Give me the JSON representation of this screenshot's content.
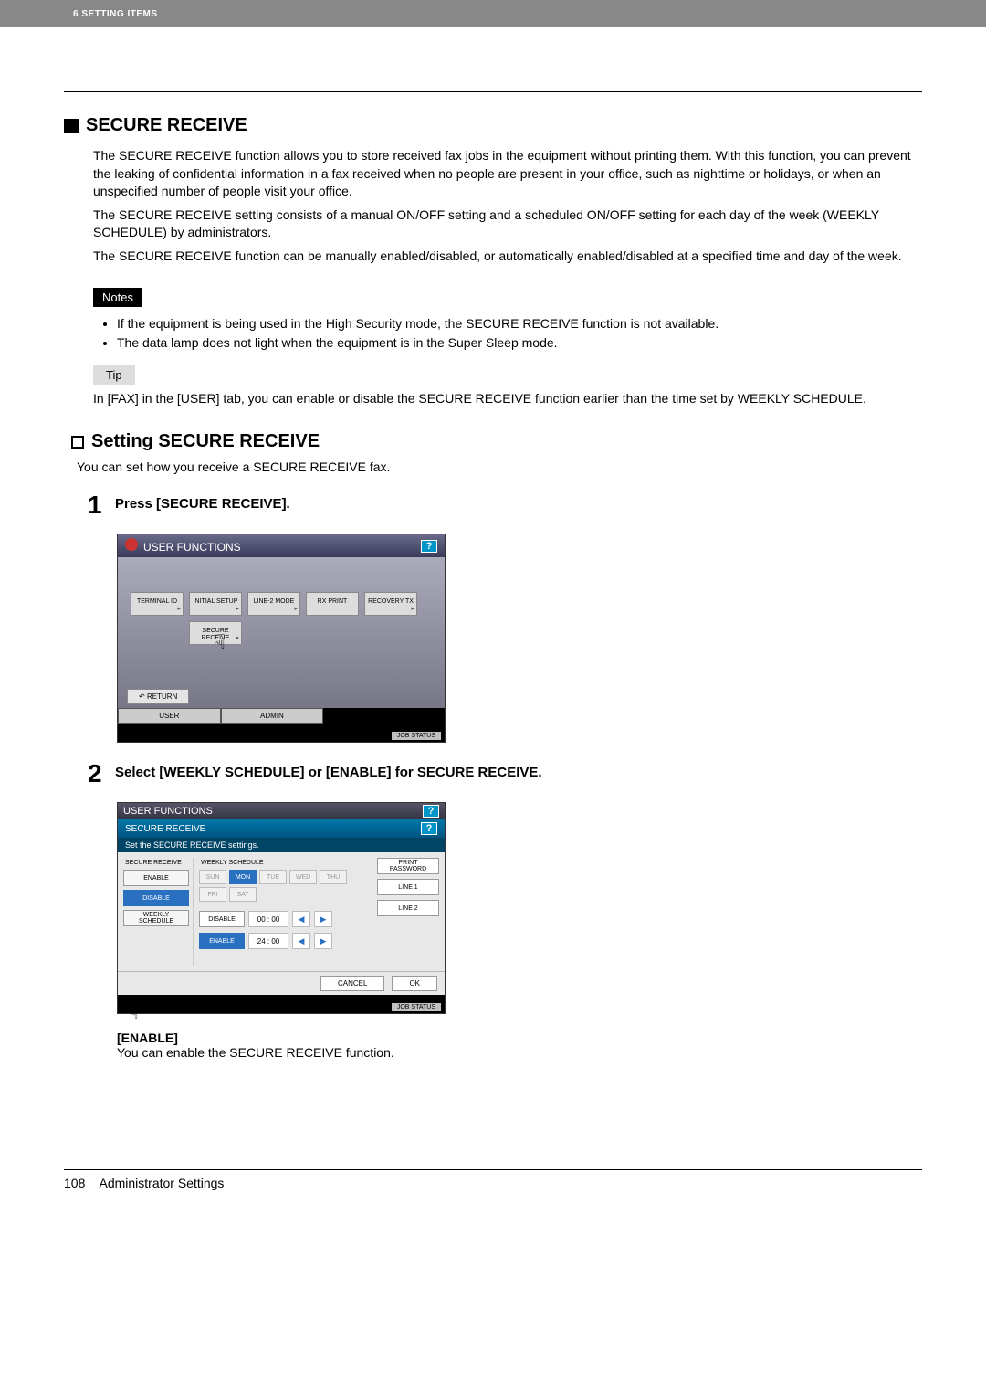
{
  "header": {
    "breadcrumb": "6 SETTING ITEMS"
  },
  "h1": "SECURE RECEIVE",
  "p1": "The SECURE RECEIVE function allows you to store received fax jobs in the equipment without printing them. With this function, you can prevent the leaking of confidential information in a fax received when no people are present in your office, such as nighttime or holidays, or when an unspecified number of people visit your office.",
  "p2": "The SECURE RECEIVE setting consists of a manual ON/OFF setting and a scheduled ON/OFF setting for each day of the week (WEEKLY SCHEDULE) by administrators.",
  "p3": "The SECURE RECEIVE function can be manually enabled/disabled, or automatically enabled/disabled at a specified time and day of the week.",
  "notes_label": "Notes",
  "note1": "If the equipment is being used in the High Security mode, the SECURE RECEIVE function is not available.",
  "note2": "The data lamp does not light when the equipment is in the Super Sleep mode.",
  "tip_label": "Tip",
  "tip_text": "In [FAX] in the [USER] tab, you can enable or disable the SECURE RECEIVE function earlier than the time set by WEEKLY SCHEDULE.",
  "h2": "Setting SECURE RECEIVE",
  "h2_desc": "You can set how you receive a SECURE RECEIVE fax.",
  "step1": {
    "num": "1",
    "title": "Press [SECURE RECEIVE]."
  },
  "step2": {
    "num": "2",
    "title": "Select [WEEKLY SCHEDULE] or [ENABLE] for SECURE RECEIVE."
  },
  "ss1": {
    "title": "USER FUNCTIONS",
    "help": "?",
    "buttons": [
      "TERMINAL ID",
      "INITIAL SETUP",
      "LINE-2 MODE",
      "RX PRINT",
      "RECOVERY TX"
    ],
    "secure": "SECURE RECEIVE",
    "return": "RETURN",
    "tabs": [
      "USER",
      "ADMIN"
    ],
    "jobstatus": "JOB STATUS"
  },
  "ss2": {
    "title1": "USER FUNCTIONS",
    "title2": "SECURE RECEIVE",
    "subtitle": "Set the SECURE RECEIVE settings.",
    "left_title": "SECURE RECEIVE",
    "left": [
      "ENABLE",
      "DISABLE",
      "WEEKLY SCHEDULE"
    ],
    "mid_title": "WEEKLY SCHEDULE",
    "days": [
      "SUN",
      "MON",
      "TUE",
      "WED",
      "THU",
      "FRI",
      "SAT"
    ],
    "disable_label": "DISABLE",
    "enable_label": "ENABLE",
    "time1": "00 : 00",
    "time2": "24 : 00",
    "right": [
      "PRINT PASSWORD",
      "LINE 1",
      "LINE 2"
    ],
    "cancel": "CANCEL",
    "ok": "OK",
    "jobstatus": "JOB STATUS",
    "help": "?"
  },
  "enable_block": {
    "label": "[ENABLE]",
    "desc": "You can enable the SECURE RECEIVE function."
  },
  "footer": {
    "page": "108",
    "title": "Administrator Settings"
  }
}
